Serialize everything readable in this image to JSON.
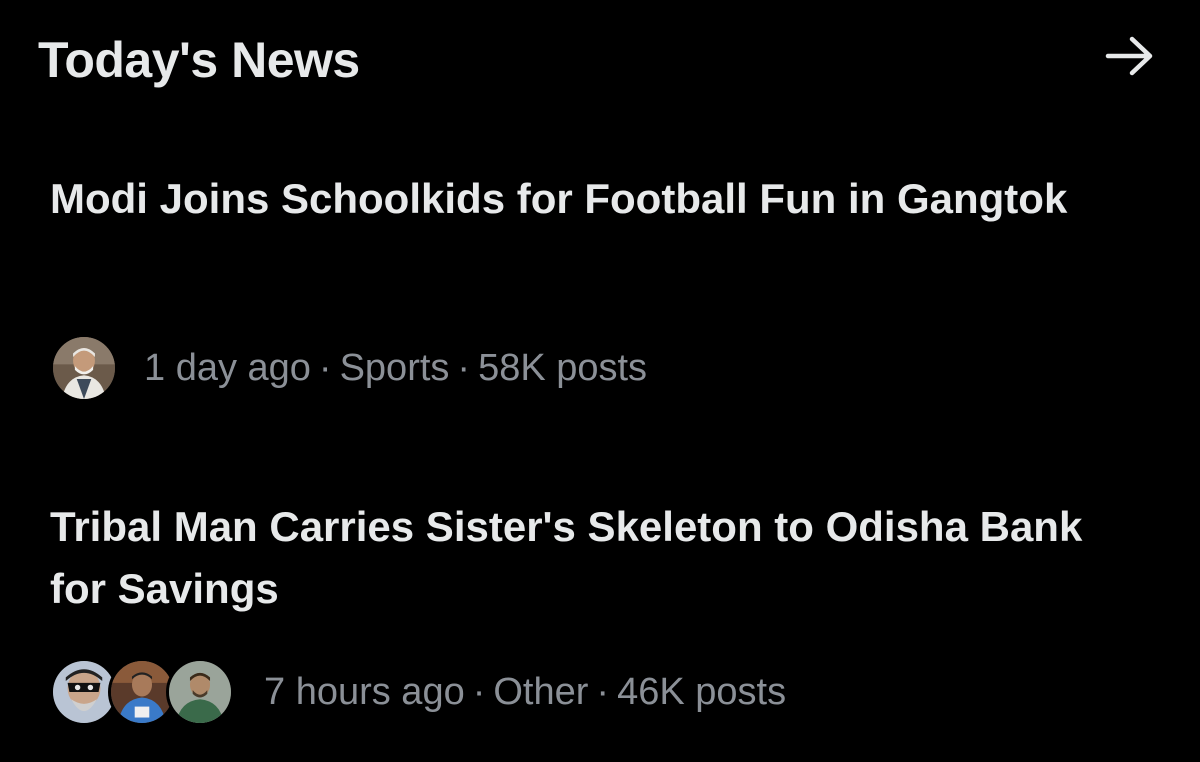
{
  "header": {
    "title": "Today's News",
    "arrow_icon": "arrow-right-icon"
  },
  "news": [
    {
      "title": "Modi Joins Schoolkids for Football Fun in Gangtok",
      "time": "1 day ago",
      "separator": "·",
      "category": "Sports",
      "posts": "58K posts",
      "avatar_count": 1
    },
    {
      "title": "Tribal Man Carries Sister's Skeleton to Odisha Bank for Savings",
      "time": "7 hours ago",
      "separator": "·",
      "category": "Other",
      "posts": "46K posts",
      "avatar_count": 3
    }
  ],
  "colors": {
    "background": "#000000",
    "primary_text": "#e7e9ea",
    "secondary_text": "#8b9097"
  }
}
